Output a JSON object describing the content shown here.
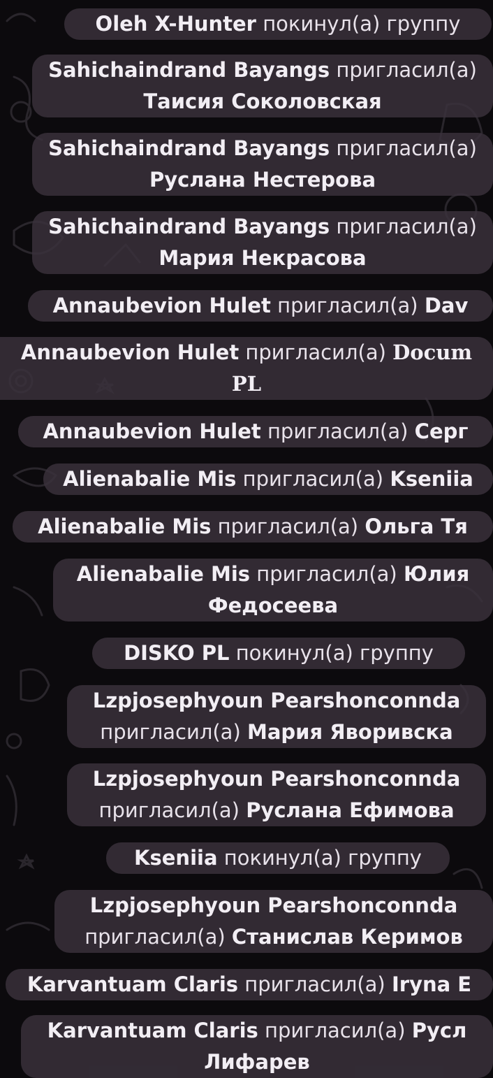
{
  "messages": [
    {
      "actor": "Oleh X-Hunter",
      "action": "покинул(а) группу",
      "target": ""
    },
    {
      "actor": "Sahichaindrand Bayangs",
      "action": "пригласил(а)",
      "target": "Таисия Соколовская"
    },
    {
      "actor": "Sahichaindrand Bayangs",
      "action": "пригласил(а)",
      "target": "Руслана Нестерова"
    },
    {
      "actor": "Sahichaindrand Bayangs",
      "action": "пригласил(а)",
      "target": "Мария Некрасова"
    },
    {
      "actor": "Annaubevion Hulet",
      "action": "пригласил(а)",
      "target": "Dav"
    },
    {
      "actor": "Annaubevion Hulet",
      "action": "пригласил(а)",
      "target": "Docum",
      "target2": "PL"
    },
    {
      "actor": "Annaubevion Hulet",
      "action": "пригласил(а)",
      "target": "Серг"
    },
    {
      "actor": "Alienabalie Mis",
      "action": "пригласил(а)",
      "target": "Kseniia"
    },
    {
      "actor": "Alienabalie Mis",
      "action": "пригласил(а)",
      "target": "Ольга Тя"
    },
    {
      "actor": "Alienabalie Mis",
      "action": "пригласил(а)",
      "target": "Юлия",
      "target2": "Федосеева"
    },
    {
      "actor": "DISKO PL",
      "action": "покинул(а) группу",
      "target": ""
    },
    {
      "actor": "Lzpjosephyoun Pearshonconnda",
      "action": "пригласил(а)",
      "target": "Мария Яворивска"
    },
    {
      "actor": "Lzpjosephyoun Pearshonconnda",
      "action": "пригласил(а)",
      "target": "Руслана Ефимова"
    },
    {
      "actor": "Kseniia",
      "action": "покинул(а) группу",
      "target": ""
    },
    {
      "actor": "Lzpjosephyoun Pearshonconnda",
      "action": "пригласил(а)",
      "target": "Станислав Керимов"
    },
    {
      "actor": "Karvantuam Claris",
      "action": "пригласил(а)",
      "target": "Iryna E"
    },
    {
      "actor": "Karvantuam Claris",
      "action": "пригласил(а)",
      "target": "Русл",
      "target2": "Лифарев"
    }
  ]
}
